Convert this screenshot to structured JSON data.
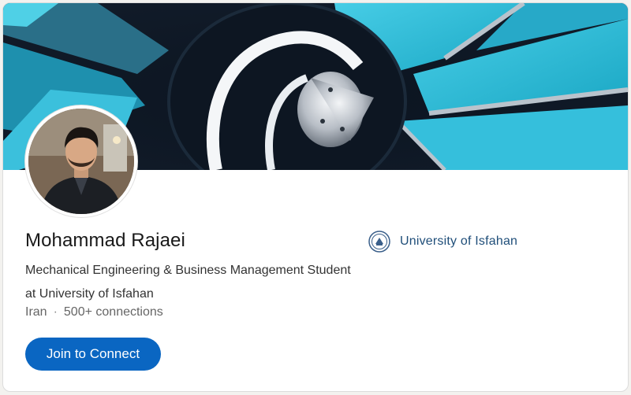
{
  "profile": {
    "name": "Mohammad Rajaei",
    "headline": "Mechanical Engineering & Business Management Student at University of Isfahan",
    "location": "Iran",
    "separator": "·",
    "connections": "500+ connections"
  },
  "actions": {
    "connect_label": "Join to Connect"
  },
  "education": {
    "school_name": "University of Isfahan",
    "logo_icon": "university-seal-icon"
  },
  "colors": {
    "primary_button": "#0a66c2",
    "school_link": "#1f4e79",
    "banner_accent": "#2fb9d6"
  }
}
